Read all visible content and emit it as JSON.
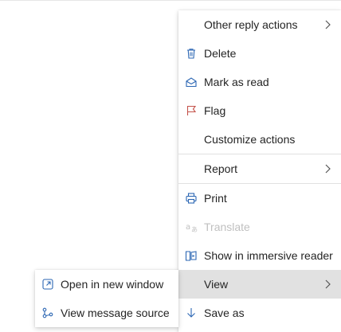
{
  "main_menu": {
    "items": [
      {
        "label": "Other reply actions"
      },
      {
        "label": "Delete"
      },
      {
        "label": "Mark as read"
      },
      {
        "label": "Flag"
      },
      {
        "label": "Customize actions"
      },
      {
        "label": "Report"
      },
      {
        "label": "Print"
      },
      {
        "label": "Translate"
      },
      {
        "label": "Show in immersive reader"
      },
      {
        "label": "View"
      },
      {
        "label": "Save as"
      }
    ]
  },
  "sub_menu": {
    "items": [
      {
        "label": "Open in new window"
      },
      {
        "label": "View message source"
      }
    ]
  },
  "colors": {
    "icon_blue": "#2b66b3",
    "flag_red": "#c4524a",
    "disabled": "#c0c0c0",
    "active_bg": "#e1e1e1"
  },
  "icons": [
    "chevron-right-icon",
    "trash-icon",
    "open-envelope-icon",
    "flag-icon",
    "printer-icon",
    "translate-icon",
    "immersive-reader-icon",
    "open-in-new-window-icon",
    "source-icon",
    "download-arrow-icon"
  ]
}
